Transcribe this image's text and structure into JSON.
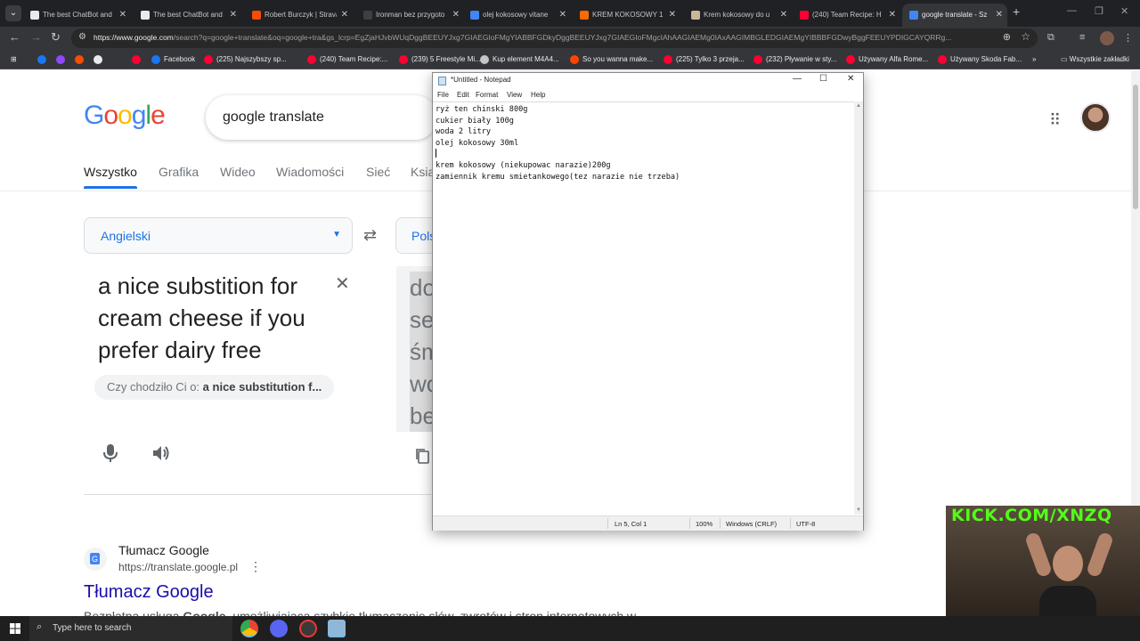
{
  "browser": {
    "tabs": [
      {
        "title": "The best ChatBot and",
        "color": "#e8eaed",
        "active": false
      },
      {
        "title": "The best ChatBot and",
        "color": "#e8eaed",
        "active": false
      },
      {
        "title": "Robert Burczyk | Strava",
        "color": "#fc4c02",
        "active": false
      },
      {
        "title": "Ironman bez przygoto",
        "color": "#3c4043",
        "active": false
      },
      {
        "title": "olej kokosowy vitane",
        "color": "#4285f4",
        "active": false
      },
      {
        "title": "KREM KOKOSOWY 1",
        "color": "#ff6a00",
        "active": false
      },
      {
        "title": "Krem kokosowy do u",
        "color": "#c8b89a",
        "active": false
      },
      {
        "title": "(240) Team Recipe: H",
        "color": "#ff0033",
        "active": false
      },
      {
        "title": "google translate - Sz",
        "color": "#4285f4",
        "active": true
      }
    ],
    "new_tab_label": "+",
    "address": {
      "domain": "https://www.google.com",
      "path": "/search?q=google+translate&oq=google+tra&gs_lcrp=EgZjaHJvbWUqDggBEEUYJxg7GIAEGIoFMgYIABBFGDkyDggBEEUYJxg7GIAEGIoFMgcIAhAAGIAEMg0IAxAAGIMBGLEDGIAEMgYIBBBFGDwyBggFEEUYPDIGCAYQRRg..."
    },
    "bookmarks": [
      {
        "label": "",
        "color": "#1877f2"
      },
      {
        "label": "",
        "color": "#9146ff"
      },
      {
        "label": "",
        "color": "#fc4c02"
      },
      {
        "label": "",
        "color": "#e8eaed"
      },
      {
        "label": "",
        "color": "#ff0033"
      },
      {
        "label": "Facebook",
        "color": "#1877f2"
      },
      {
        "label": "(225) Najszybszy sp...",
        "color": "#ff0033"
      },
      {
        "label": "(240) Team Recipe:...",
        "color": "#ff0033"
      },
      {
        "label": "(239) 5 Freestyle Mi...",
        "color": "#ff0033"
      },
      {
        "label": "Kup element M4A4...",
        "color": "#c4c7c5"
      },
      {
        "label": "So you wanna make...",
        "color": "#ff4500"
      },
      {
        "label": "(225) Tylko 3 przeja...",
        "color": "#ff0033"
      },
      {
        "label": "(232) Pływanie w sty...",
        "color": "#ff0033"
      },
      {
        "label": "Używany Alfa Rome...",
        "color": "#ff0033"
      },
      {
        "label": "Używany Skoda Fab...",
        "color": "#ff0033"
      }
    ],
    "bookmarks_more": "»",
    "all_bookmarks": "Wszystkie zakładki"
  },
  "google": {
    "logo": "Google",
    "query": "google translate",
    "tabs": [
      "Wszystko",
      "Grafika",
      "Wideo",
      "Wiadomości",
      "Sieć",
      "Ksią"
    ],
    "source_lang": "Angielski",
    "target_lang": "Pols",
    "source_text": "a nice substition for cream cheese if you prefer dairy free",
    "did_you_mean_prefix": "Czy chodziło Ci o:",
    "did_you_mean_suggestion": "a nice substitution f...",
    "target_text_lines": [
      "do",
      "se",
      "śm",
      "wo",
      "be"
    ],
    "result": {
      "site_name": "Tłumacz Google",
      "url": "https://translate.google.pl",
      "title": "Tłumacz Google",
      "snippet_prefix": "Bezpłatna usługa ",
      "snippet_bold": "Google",
      "snippet_rest": ", umożliwiająca szybkie tłumaczenie słów, zwrotów i stron internetowych w..."
    }
  },
  "notepad": {
    "title": "*Untitled - Notepad",
    "menu": [
      "File",
      "Edit",
      "Format",
      "View",
      "Help"
    ],
    "lines": [
      "ryż ten chinski 800g",
      "cukier biały 100g",
      "woda 2 litry",
      "olej kokosowy 30ml",
      "",
      "krem kokosowy (niekupowac narazie)200g",
      "zamiennik kremu smietankowego(tez narazie nie trzeba)"
    ],
    "status": {
      "position": "Ln 5, Col 1",
      "zoom": "100%",
      "line_ending": "Windows (CRLF)",
      "encoding": "UTF-8"
    }
  },
  "webcam": {
    "overlay_text": "KICK.COM/XNZQ"
  },
  "taskbar": {
    "search_placeholder": "Type here to search"
  }
}
